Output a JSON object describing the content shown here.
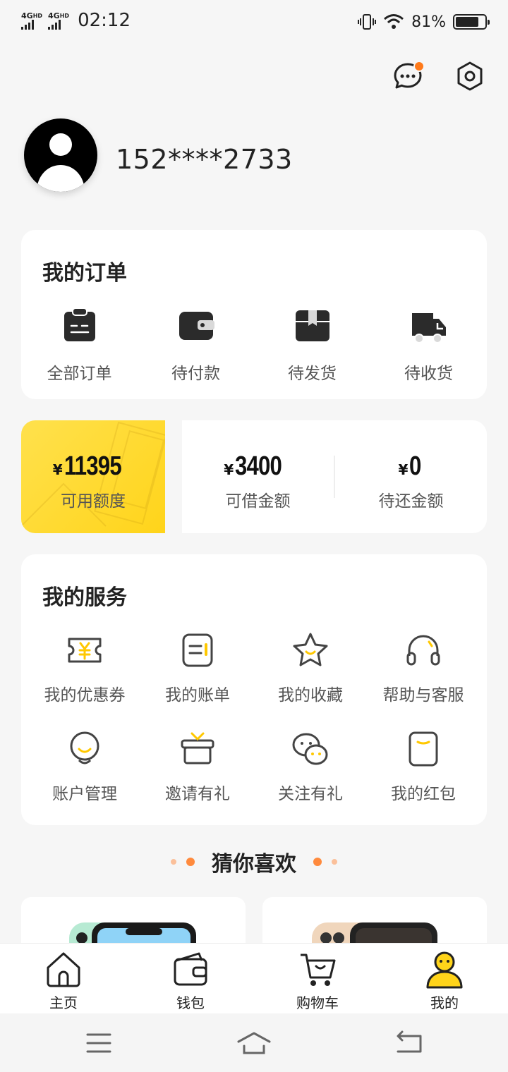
{
  "status_bar": {
    "network_1": "4G",
    "network_1_sup": "HD",
    "network_2": "4G",
    "network_2_sup": "HD",
    "time": "02:12",
    "battery": "81%",
    "battery_level": 0.81
  },
  "header": {
    "message_icon": "chat-bubble-icon",
    "settings_icon": "gear-icon",
    "has_new_message": true
  },
  "profile": {
    "username": "152****2733"
  },
  "orders": {
    "title": "我的订单",
    "items": [
      {
        "label": "全部订单",
        "icon": "clipboard-icon"
      },
      {
        "label": "待付款",
        "icon": "wallet-icon"
      },
      {
        "label": "待发货",
        "icon": "box-icon"
      },
      {
        "label": "待收货",
        "icon": "truck-icon"
      }
    ]
  },
  "credit": {
    "currency": "¥",
    "available": {
      "value": "11395",
      "label": "可用额度"
    },
    "borrowable": {
      "value": "3400",
      "label": "可借金额"
    },
    "to_repay": {
      "value": "0",
      "label": "待还金额"
    }
  },
  "services": {
    "title": "我的服务",
    "items": [
      {
        "label": "我的优惠券",
        "icon": "coupon-icon"
      },
      {
        "label": "我的账单",
        "icon": "bill-icon"
      },
      {
        "label": "我的收藏",
        "icon": "star-icon"
      },
      {
        "label": "帮助与客服",
        "icon": "headset-icon"
      },
      {
        "label": "账户管理",
        "icon": "account-icon"
      },
      {
        "label": "邀请有礼",
        "icon": "gift-icon"
      },
      {
        "label": "关注有礼",
        "icon": "wechat-icon"
      },
      {
        "label": "我的红包",
        "icon": "red-packet-icon"
      }
    ]
  },
  "recommend": {
    "title": "猜你喜欢"
  },
  "tabbar": {
    "items": [
      {
        "label": "主页",
        "icon": "home-icon"
      },
      {
        "label": "钱包",
        "icon": "wallet-icon"
      },
      {
        "label": "购物车",
        "icon": "cart-icon"
      },
      {
        "label": "我的",
        "icon": "profile-icon"
      }
    ],
    "active": "我的"
  },
  "colors": {
    "accent": "#ffd41a",
    "badge": "#ff7a1a",
    "background": "#f6f6f6",
    "icon_dark": "#2b2b2b"
  }
}
